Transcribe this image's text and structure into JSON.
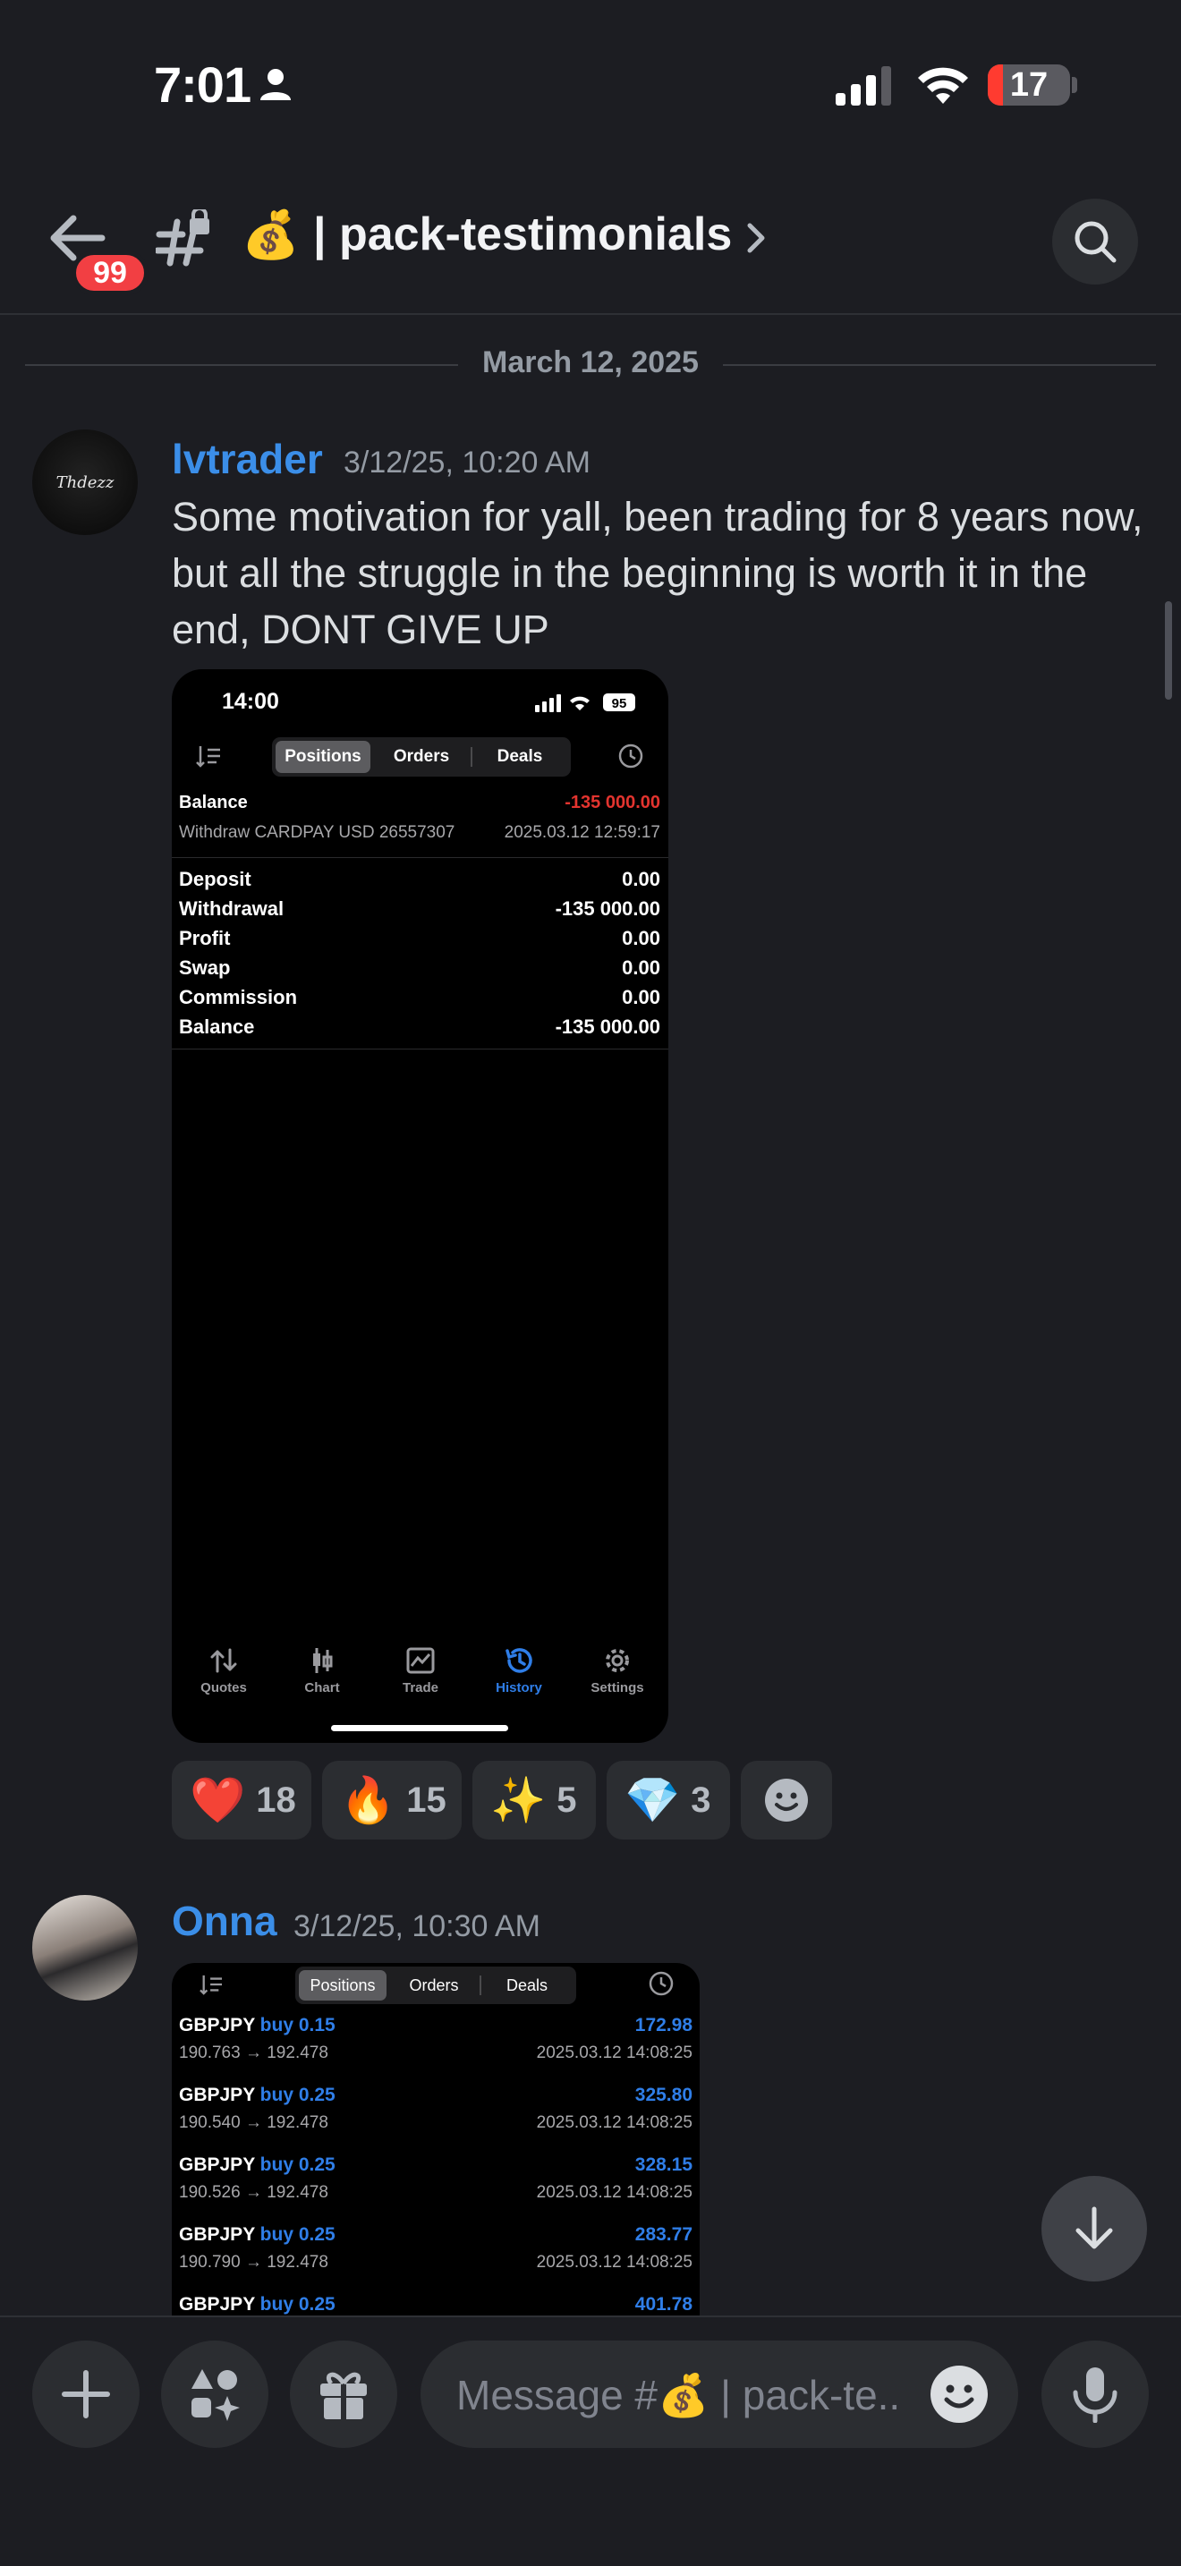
{
  "status_bar": {
    "time": "7:01",
    "battery": "17"
  },
  "header": {
    "back_badge": "99",
    "channel_emoji": "💰",
    "channel_name": "| pack-testimonials"
  },
  "date_divider": "March 12, 2025",
  "message1": {
    "author": "lvtrader",
    "timestamp": "3/12/25, 10:20 AM",
    "avatar_text": "Thdezz",
    "text": "Some motivation for yall, been trading for 8 years now, but all the struggle in the beginning is worth it in the end, DONT GIVE UP",
    "screenshot": {
      "time": "14:00",
      "battery": "95",
      "tabs": [
        "Positions",
        "Orders",
        "Deals"
      ],
      "balance_label": "Balance",
      "balance_value": "-135 000.00",
      "withdraw_desc": "Withdraw CARDPAY USD 26557307",
      "withdraw_time": "2025.03.12 12:59:17",
      "summary": [
        {
          "label": "Deposit",
          "value": "0.00"
        },
        {
          "label": "Withdrawal",
          "value": "-135 000.00"
        },
        {
          "label": "Profit",
          "value": "0.00"
        },
        {
          "label": "Swap",
          "value": "0.00"
        },
        {
          "label": "Commission",
          "value": "0.00"
        },
        {
          "label": "Balance",
          "value": "-135 000.00"
        }
      ],
      "bottom_tabs": [
        "Quotes",
        "Chart",
        "Trade",
        "History",
        "Settings"
      ],
      "active_bottom_tab": "History",
      "accent_color": "#2f7ee8",
      "negative_color": "#e3342f"
    }
  },
  "reactions": [
    {
      "emoji": "❤️",
      "count": "18"
    },
    {
      "emoji": "🔥",
      "count": "15"
    },
    {
      "emoji": "✨",
      "count": "5"
    },
    {
      "emoji": "💎",
      "count": "3"
    }
  ],
  "message2": {
    "author": "Onna",
    "timestamp": "3/12/25, 10:30 AM",
    "screenshot": {
      "tabs": [
        "Positions",
        "Orders",
        "Deals"
      ],
      "positions": [
        {
          "symbol": "GBPJPY",
          "side": "buy 0.15",
          "profit": "172.98",
          "prices": "190.763 → 192.478",
          "time": "2025.03.12 14:08:25"
        },
        {
          "symbol": "GBPJPY",
          "side": "buy 0.25",
          "profit": "325.80",
          "prices": "190.540 → 192.478",
          "time": "2025.03.12 14:08:25"
        },
        {
          "symbol": "GBPJPY",
          "side": "buy 0.25",
          "profit": "328.15",
          "prices": "190.526 → 192.478",
          "time": "2025.03.12 14:08:25"
        },
        {
          "symbol": "GBPJPY",
          "side": "buy 0.25",
          "profit": "283.77",
          "prices": "190.790 → 192.478",
          "time": "2025.03.12 14:08:25"
        },
        {
          "symbol": "GBPJPY",
          "side": "buy 0.25",
          "profit": "401.78",
          "prices": "",
          "time": ""
        }
      ]
    }
  },
  "composer": {
    "placeholder": "Message #💰 | pack-te.."
  },
  "colors": {
    "background": "#1c1d22",
    "author_name": "#3b8ee8",
    "badge_red": "#f23f43"
  },
  "icons": {
    "back": "arrow-left-icon",
    "channel": "hash-lock-icon",
    "search": "search-icon",
    "add": "plus-icon",
    "apps": "apps-icon",
    "gift": "gift-icon",
    "emoji": "emoji-icon",
    "mic": "microphone-icon",
    "scroll_down": "arrow-down-icon"
  }
}
